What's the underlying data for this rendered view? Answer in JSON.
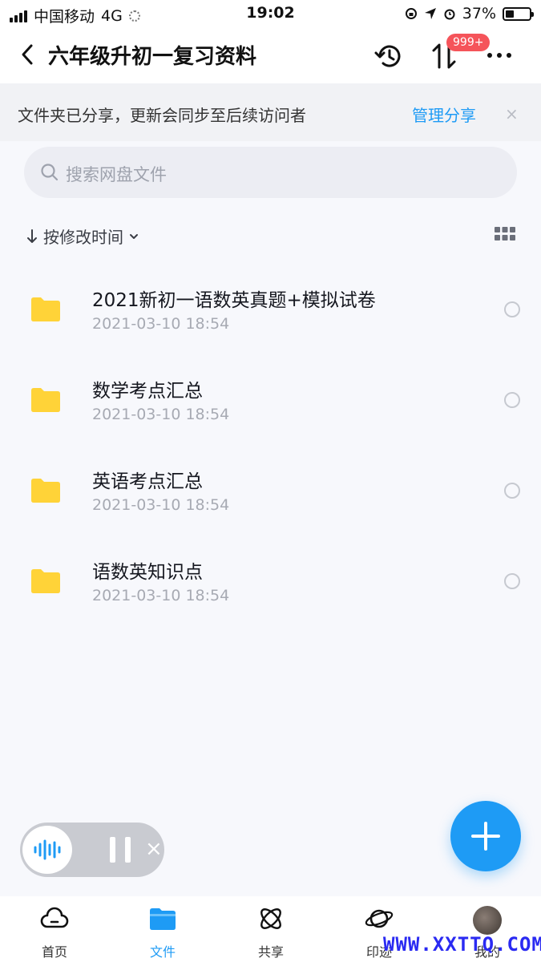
{
  "status_bar": {
    "carrier": "中国移动",
    "network": "4G",
    "time": "19:02",
    "battery": "37%"
  },
  "header": {
    "title": "六年级升初一复习资料",
    "badge": "999+"
  },
  "share_notice": {
    "text": "文件夹已分享，更新会同步至后续访问者",
    "manage_label": "管理分享",
    "close": "×"
  },
  "search": {
    "placeholder": "搜索网盘文件"
  },
  "sort": {
    "label": "按修改时间"
  },
  "files": [
    {
      "name": "2021新初一语数英真题+模拟试卷",
      "date": "2021-03-10 18:54"
    },
    {
      "name": "数学考点汇总",
      "date": "2021-03-10 18:54"
    },
    {
      "name": "英语考点汇总",
      "date": "2021-03-10 18:54"
    },
    {
      "name": "语数英知识点",
      "date": "2021-03-10 18:54"
    }
  ],
  "voice_widget": {
    "close": "×"
  },
  "tabs": [
    {
      "label": "首页",
      "icon": "cloud-icon",
      "active": false
    },
    {
      "label": "文件",
      "icon": "folder-icon",
      "active": true
    },
    {
      "label": "共享",
      "icon": "atom-icon",
      "active": false
    },
    {
      "label": "印迹",
      "icon": "planet-icon",
      "active": false
    },
    {
      "label": "我的",
      "icon": "avatar",
      "active": false
    }
  ],
  "watermark": "WWW.XXTTQ.COM",
  "colors": {
    "accent": "#1e9bf5",
    "folder": "#ffd338",
    "badge": "#f5545a"
  }
}
